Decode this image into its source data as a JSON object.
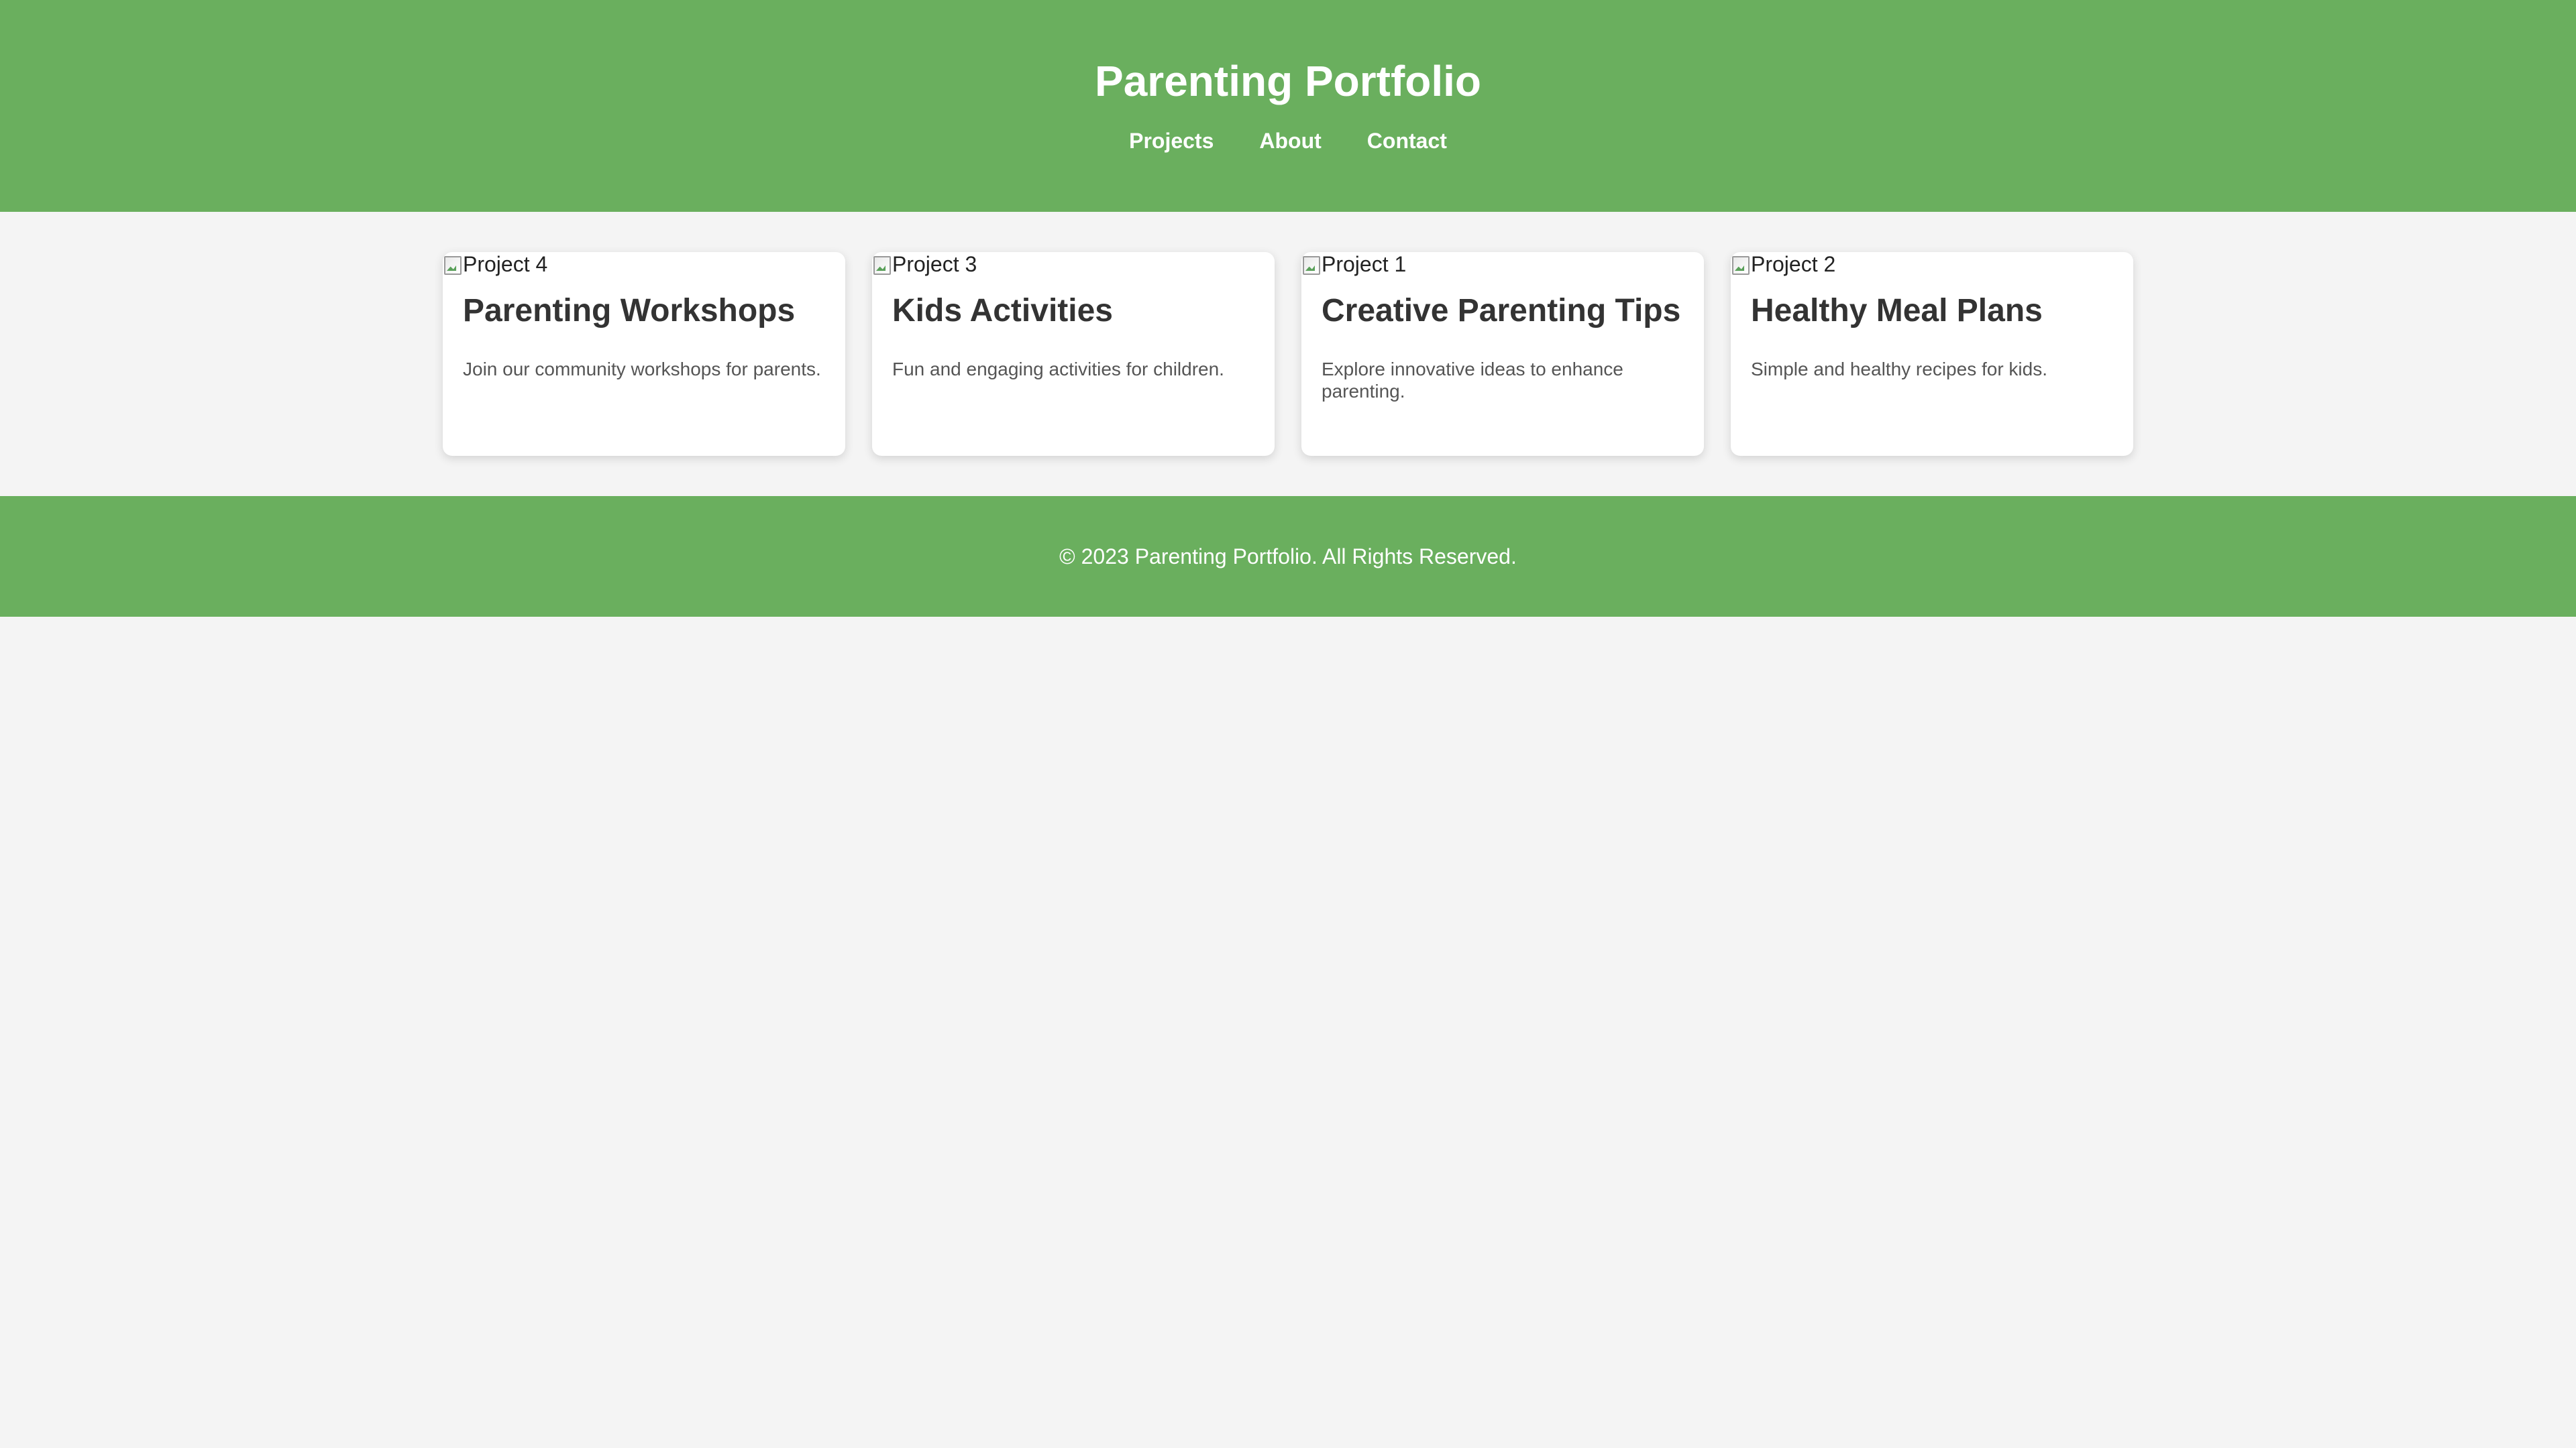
{
  "header": {
    "title": "Parenting Portfolio",
    "nav": [
      "Projects",
      "About",
      "Contact"
    ]
  },
  "projects": [
    {
      "image_alt": "Project 4",
      "title": "Parenting Workshops",
      "description": "Join our community workshops for parents."
    },
    {
      "image_alt": "Project 3",
      "title": "Kids Activities",
      "description": "Fun and engaging activities for children."
    },
    {
      "image_alt": "Project 1",
      "title": "Creative Parenting Tips",
      "description": "Explore innovative ideas to enhance parenting."
    },
    {
      "image_alt": "Project 2",
      "title": "Healthy Meal Plans",
      "description": "Simple and healthy recipes for kids."
    }
  ],
  "footer": {
    "text": "© 2023 Parenting Portfolio. All Rights Reserved."
  },
  "colors": {
    "brand": "#6aaf5e",
    "background": "#f4f4f4",
    "card": "#ffffff",
    "heading": "#333333",
    "body_text": "#555555"
  },
  "icons": {
    "card_image": "broken-image-icon"
  }
}
